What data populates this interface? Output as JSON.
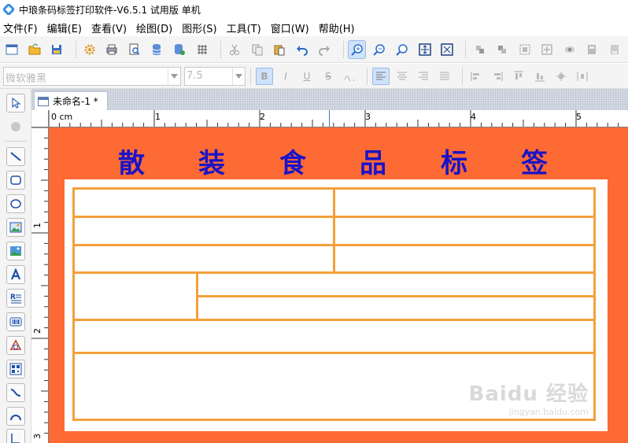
{
  "window": {
    "title": "中琅条码标签打印软件-V6.5.1 试用版 单机"
  },
  "menu": [
    {
      "label": "文件(F)"
    },
    {
      "label": "编辑(E)"
    },
    {
      "label": "查看(V)"
    },
    {
      "label": "绘图(D)"
    },
    {
      "label": "图形(S)"
    },
    {
      "label": "工具(T)"
    },
    {
      "label": "窗口(W)"
    },
    {
      "label": "帮助(H)"
    }
  ],
  "format": {
    "font": "微软雅黑",
    "size": "7.5",
    "bold": "B",
    "italic": "I",
    "underline": "U",
    "strike": "S"
  },
  "document": {
    "tab_title": "未命名-1 *"
  },
  "ruler": {
    "unit_label": "0 cm",
    "h_marks": [
      "1",
      "2",
      "3",
      "4",
      "5"
    ],
    "v_marks": [
      "1",
      "2",
      "3"
    ]
  },
  "label": {
    "title": [
      "散",
      "装",
      "食",
      "品",
      "标",
      "签"
    ],
    "background_color": "#fe6a34",
    "title_color": "#1a13c7",
    "line_color": "#f4a03b"
  },
  "watermark": {
    "main": "Baidu 经验",
    "sub": "jingyan.baidu.com"
  }
}
